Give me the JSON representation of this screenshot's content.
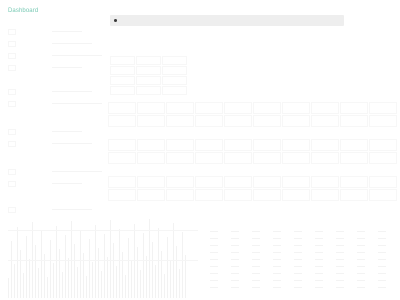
{
  "app": {
    "brand_label": "Dashboard"
  },
  "colors": {
    "brand": "#78c9b4",
    "search_bar": "#eeeeee",
    "faint_ui": "#f5f5f5"
  },
  "footer": {
    "label_1": "",
    "label_2": ""
  }
}
